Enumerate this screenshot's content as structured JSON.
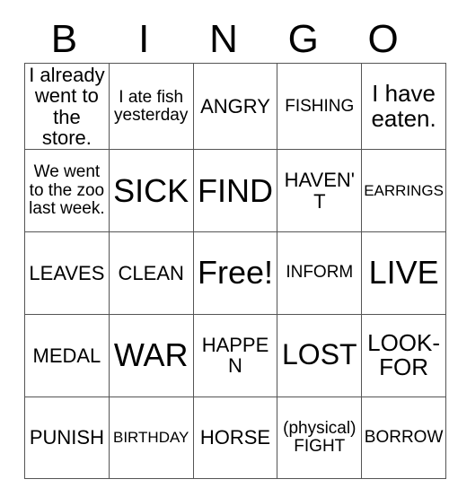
{
  "card": {
    "header_letters": [
      "B",
      "I",
      "N",
      "G",
      "O"
    ],
    "columns": 5,
    "rows": 5,
    "border_color": "#555555",
    "background_color": "#ffffff",
    "text_color": "#000000",
    "free_space_label": "Free!",
    "cells": [
      [
        {
          "text": "I already went to the store.",
          "size": "fs-md"
        },
        {
          "text": "I ate fish yesterday",
          "size": "fs-sm"
        },
        {
          "text": "ANGRY",
          "size": "fs-md"
        },
        {
          "text": "FISHING",
          "size": "fs-sm"
        },
        {
          "text": "I have eaten.",
          "size": "fs-lg"
        }
      ],
      [
        {
          "text": "We went to the zoo last week.",
          "size": "fs-sm"
        },
        {
          "text": "SICK",
          "size": "fs-xxl"
        },
        {
          "text": "FIND",
          "size": "fs-xxl"
        },
        {
          "text": "HAVEN'T",
          "size": "fs-md"
        },
        {
          "text": "EARRINGS",
          "size": "fs-xs"
        }
      ],
      [
        {
          "text": "LEAVES",
          "size": "fs-md"
        },
        {
          "text": "CLEAN",
          "size": "fs-md"
        },
        {
          "text": "Free!",
          "size": "fs-xxl"
        },
        {
          "text": "INFORM",
          "size": "fs-sm"
        },
        {
          "text": "LIVE",
          "size": "fs-xxl"
        }
      ],
      [
        {
          "text": "MEDAL",
          "size": "fs-md"
        },
        {
          "text": "WAR",
          "size": "fs-xxl"
        },
        {
          "text": "HAPPEN",
          "size": "fs-md"
        },
        {
          "text": "LOST",
          "size": "fs-xl"
        },
        {
          "text": "LOOK-FOR",
          "size": "fs-lg"
        }
      ],
      [
        {
          "text": "PUNISH",
          "size": "fs-md"
        },
        {
          "text": "BIRTHDAY",
          "size": "fs-xs"
        },
        {
          "text": "HORSE",
          "size": "fs-md"
        },
        {
          "text": "(physical) FIGHT",
          "size": "fs-sm"
        },
        {
          "text": "BORROW",
          "size": "fs-sm"
        }
      ]
    ]
  }
}
